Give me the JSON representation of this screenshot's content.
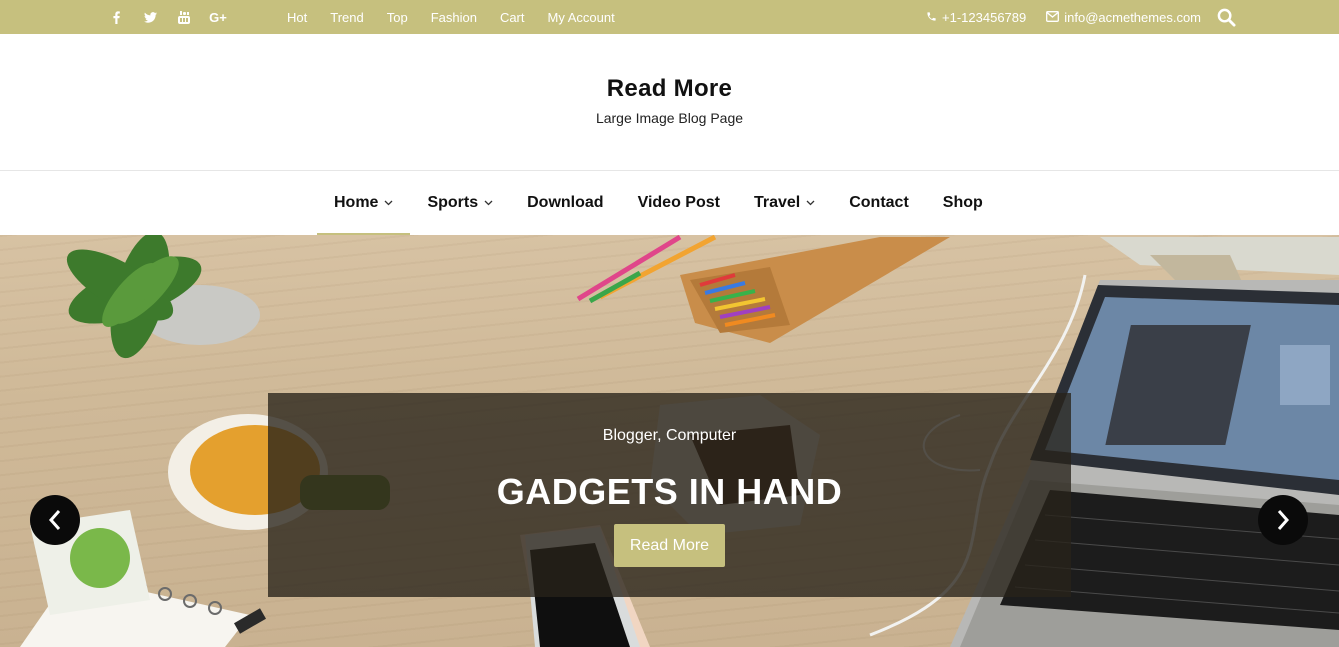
{
  "topbar": {
    "social": [
      "facebook-icon",
      "twitter-icon",
      "youtube-icon",
      "google-plus-icon"
    ],
    "social_gplus_text": "G+",
    "nav": [
      "Hot",
      "Trend",
      "Top",
      "Fashion",
      "Cart",
      "My Account"
    ],
    "phone": "+1-123456789",
    "email": "info@acmethemes.com",
    "bg_color": "#c6c07e"
  },
  "branding": {
    "title": "Read More",
    "description": "Large Image Blog Page"
  },
  "main_nav": {
    "items": [
      {
        "label": "Home",
        "has_dropdown": true,
        "active": true
      },
      {
        "label": "Sports",
        "has_dropdown": true
      },
      {
        "label": "Download",
        "has_dropdown": false
      },
      {
        "label": "Video Post",
        "has_dropdown": false
      },
      {
        "label": "Travel",
        "has_dropdown": true
      },
      {
        "label": "Contact",
        "has_dropdown": false
      },
      {
        "label": "Shop",
        "has_dropdown": false
      }
    ]
  },
  "slider": {
    "categories": "Blogger, Computer",
    "title": "GADGETS IN HAND",
    "button_label": "Read More",
    "accent_color": "#c6c07e"
  }
}
